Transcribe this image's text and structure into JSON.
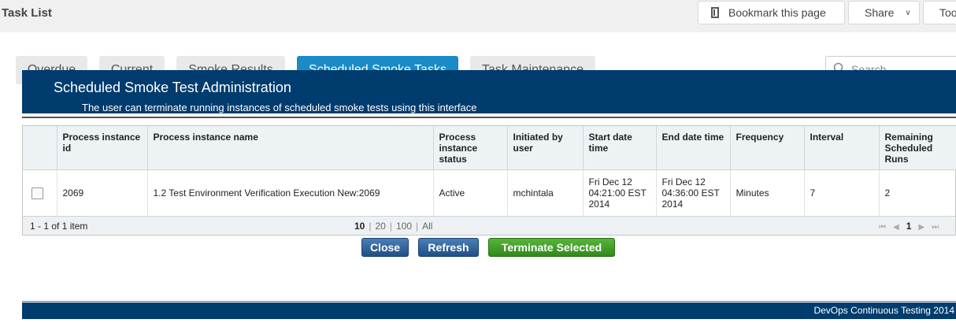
{
  "header": {
    "title": "Task List",
    "bookmark_label": "Bookmark this page",
    "share_label": "Share",
    "tools_label": "Tools"
  },
  "tabs": [
    {
      "label": "Overdue",
      "active": false
    },
    {
      "label": "Current",
      "active": false
    },
    {
      "label": "Smoke Results",
      "active": false
    },
    {
      "label": "Scheduled Smoke Tasks",
      "active": true
    },
    {
      "label": "Task Maintenance",
      "active": false
    }
  ],
  "search": {
    "placeholder": "Search"
  },
  "panel": {
    "title": "Scheduled Smoke Test Administration",
    "subtitle": "The user can terminate running instances of scheduled smoke tests using this interface"
  },
  "table": {
    "columns": [
      "Process instance id",
      "Process instance name",
      "Process instance status",
      "Initiated by user",
      "Start date time",
      "End date time",
      "Frequency",
      "Interval",
      "Remaining Scheduled Runs"
    ],
    "rows": [
      {
        "checked": false,
        "cells": [
          "2069",
          "1.2 Test Environment Verification Execution New:2069",
          "Active",
          "mchintala",
          "Fri Dec 12 04:21:00 EST 2014",
          "Fri Dec 12 04:36:00 EST 2014",
          "Minutes",
          "7",
          "2"
        ]
      }
    ]
  },
  "pager": {
    "info": "1 - 1 of 1 item",
    "sizes": [
      "10",
      "20",
      "100",
      "All"
    ],
    "current_page": "1"
  },
  "buttons": {
    "close": "Close",
    "refresh": "Refresh",
    "terminate": "Terminate Selected"
  },
  "footer": {
    "text": "DevOps Continuous Testing 2014"
  },
  "colors": {
    "accent": "#1a8bc6",
    "header_bg": "#003c6e",
    "terminate_green": "#3f9d25"
  }
}
